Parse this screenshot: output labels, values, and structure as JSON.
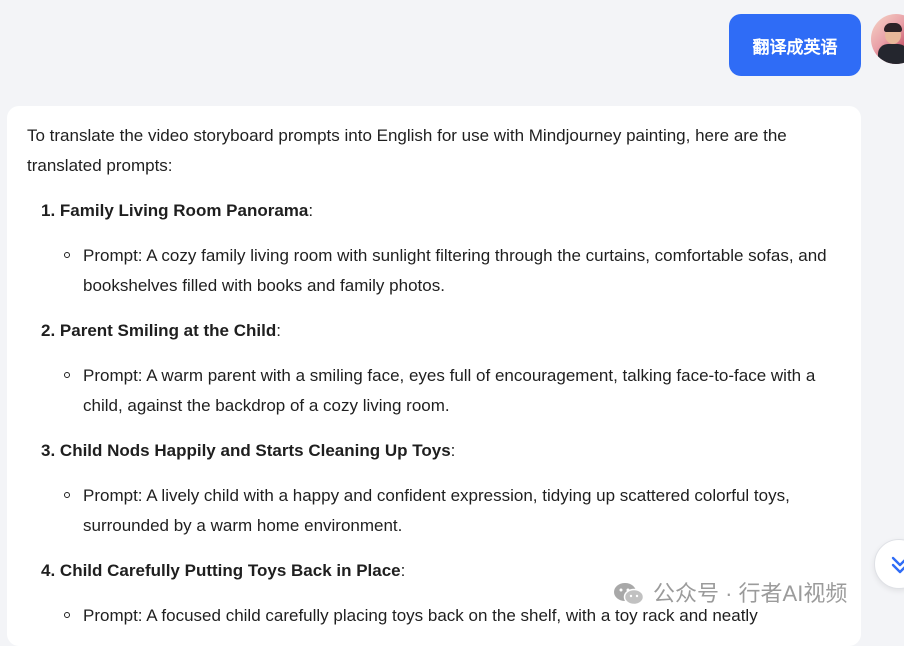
{
  "user_message": {
    "text": "翻译成英语"
  },
  "assistant_message": {
    "intro": "To translate the video storyboard prompts into English for use with Mindjourney painting, here are the translated prompts:",
    "items": [
      {
        "number": "1.",
        "title": "Family Living Room Panorama",
        "prompt": "Prompt: A cozy family living room with sunlight filtering through the curtains, comfortable sofas, and bookshelves filled with books and family photos."
      },
      {
        "number": "2.",
        "title": "Parent Smiling at the Child",
        "prompt": "Prompt: A warm parent with a smiling face, eyes full of encouragement, talking face-to-face with a child, against the backdrop of a cozy living room."
      },
      {
        "number": "3.",
        "title": "Child Nods Happily and Starts Cleaning Up Toys",
        "prompt": "Prompt: A lively child with a happy and confident expression, tidying up scattered colorful toys, surrounded by a warm home environment."
      },
      {
        "number": "4.",
        "title": "Child Carefully Putting Toys Back in Place",
        "prompt": "Prompt: A focused child carefully placing toys back on the shelf, with a toy rack and neatly"
      }
    ]
  },
  "watermark": {
    "text": "公众号 · 行者AI视频"
  },
  "icons": {
    "scroll_down": "double-chevron-down-icon",
    "wechat": "wechat-icon"
  },
  "colors": {
    "accent": "#2f6cf6",
    "background": "#f3f4f7",
    "card": "#ffffff",
    "text": "#1f1f1f"
  }
}
